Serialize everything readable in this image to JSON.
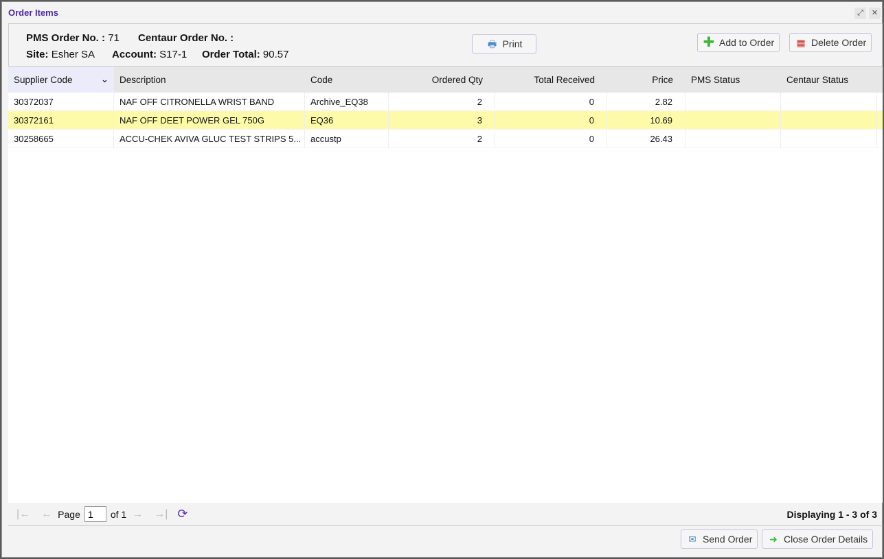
{
  "window": {
    "title": "Order Items"
  },
  "header": {
    "pms_label": "PMS Order No. :",
    "pms_value": "71",
    "centaur_label": "Centaur Order No. :",
    "centaur_value": "",
    "site_label": "Site:",
    "site_value": "Esher SA",
    "account_label": "Account:",
    "account_value": "S17-1",
    "total_label": "Order Total:",
    "total_value": "90.57"
  },
  "toolbar": {
    "print": "Print",
    "add": "Add to Order",
    "delete": "Delete Order"
  },
  "columns": [
    "Supplier Code",
    "Description",
    "Code",
    "Ordered Qty",
    "Total Received",
    "Price",
    "PMS Status",
    "Centaur Status"
  ],
  "rows": [
    [
      "30372037",
      "NAF OFF CITRONELLA WRIST BAND",
      "Archive_EQ38",
      "2",
      "0",
      "2.82",
      "",
      ""
    ],
    [
      "30372161",
      "NAF OFF DEET POWER GEL 750G",
      "EQ36",
      "3",
      "0",
      "10.69",
      "",
      ""
    ],
    [
      "30258665",
      "ACCU-CHEK AVIVA GLUC TEST STRIPS 5...",
      "accustp",
      "2",
      "0",
      "26.43",
      "",
      ""
    ]
  ],
  "pager": {
    "page_label": "Page",
    "page": "1",
    "of_label": "of 1",
    "displaying": "Displaying 1 - 3 of 3"
  },
  "footer": {
    "send": "Send Order",
    "close": "Close Order Details"
  }
}
